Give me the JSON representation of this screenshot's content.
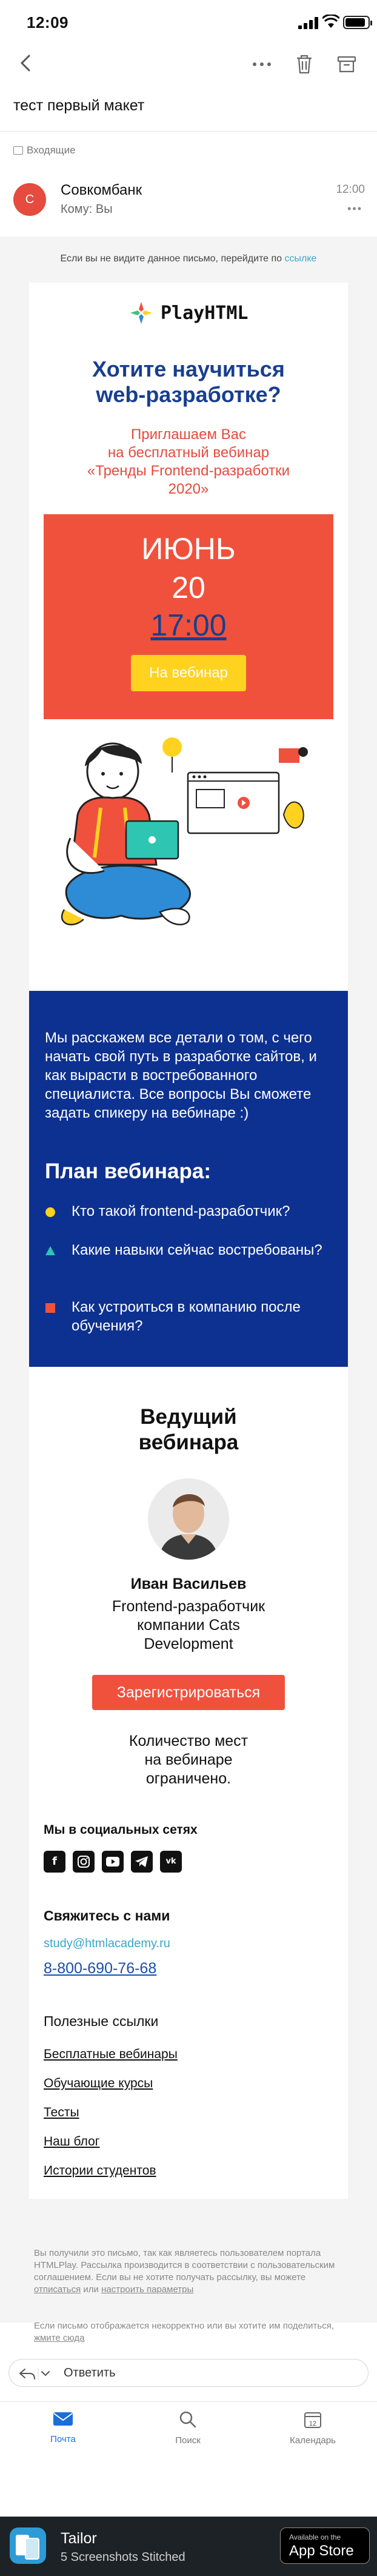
{
  "status_bar": {
    "time": "12:09"
  },
  "navbar": {
    "back_icon": "chevron-left-icon",
    "more_icon": "more-dots-icon",
    "trash_icon": "trash-icon",
    "archive_icon": "archive-icon"
  },
  "subject": "тест первый макет",
  "folder": {
    "label": "Входящие",
    "icon": "folder-icon"
  },
  "sender": {
    "initial": "С",
    "name": "Совкомбанк",
    "to": "Кому: Вы",
    "time": "12:00",
    "more": "•••"
  },
  "email": {
    "preline_text": "Если вы не видите данное письмо, перейдите по",
    "preline_link": "ссылке",
    "logo_text": "PlayHTML",
    "headline": [
      "Хотите научиться",
      "web-разработке?"
    ],
    "invite": [
      "Приглашаем Вас",
      "на бесплатный вебинар",
      "«Тренды Frontend-разработки",
      "2020»"
    ],
    "date": {
      "month": "ИЮНЬ",
      "day": "20",
      "time": "17:00",
      "button": "На вебинар"
    },
    "intro": "Мы расскажем все детали о том, с чего начать свой путь в разработке сайтов, и как вырасти в востребованного специалиста. Все вопросы Вы сможете задать спикеру на вебинаре :)",
    "plan_title": "План вебинара:",
    "plan_items": [
      "Кто такой frontend-разработчик?",
      "Какие навыки сейчас востребованы?",
      "Как устроиться в компанию после обучения?"
    ],
    "host_title": [
      "Ведущий",
      "вебинара"
    ],
    "host_name": "Иван Васильев",
    "host_role": [
      "Frontend-разработчик",
      "компании Cats",
      "Development"
    ],
    "register_button": "Зарегистрироваться",
    "limit": [
      "Количество мест",
      "на вебинаре",
      "ограничено."
    ],
    "social_title": "Мы в социальных сетях",
    "social_icons": [
      "facebook-icon",
      "instagram-icon",
      "youtube-icon",
      "telegram-icon",
      "vk-icon"
    ],
    "contact_title": "Свяжитесь с нами",
    "contact_email": "study@htmlacademy.ru",
    "contact_phone": "8-800-690-76-68",
    "links_title": "Полезные ссылки",
    "links": [
      "Бесплатные вебинары",
      "Обучающие курсы",
      "Тесты",
      "Наш блог",
      "Истории студентов"
    ],
    "footer_1a": "Вы получили это письмо, так как являетесь пользователем портала HTMLPlay. Рассылка производится в соответствии с пользовательским соглашением. Если",
    "footer_1b": "вы не хотите получать рассылку, вы можете",
    "footer_1_link_a": "отписаться",
    "footer_1c": "или",
    "footer_1_link_b": "настроить параметры",
    "footer_2a": "Если письмо отображается некорректно или вы хотите им поделиться,",
    "footer_2_link": "жмите сюда"
  },
  "reply": {
    "placeholder": "Ответить"
  },
  "tabs": [
    {
      "label": "Почта",
      "icon": "mail-icon"
    },
    {
      "label": "Поиск",
      "icon": "search-icon"
    },
    {
      "label": "Календарь",
      "icon": "calendar-icon",
      "day": "12"
    }
  ],
  "banner": {
    "title": "Tailor",
    "subtitle": "5 Screenshots Stitched",
    "store_small": "Available on the",
    "store_big": "App Store"
  },
  "colors": {
    "accent_red": "#f0513d",
    "accent_blue": "#0d3190",
    "link_blue": "#3aa7c9",
    "yellow": "#ffd21f",
    "tab_active": "#1a6fd8"
  }
}
